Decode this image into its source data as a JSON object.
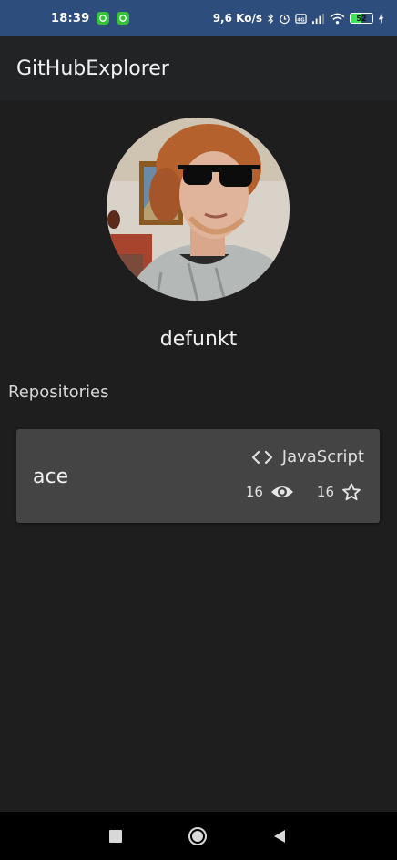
{
  "status_bar": {
    "time": "18:39",
    "network_speed": "9,6 Ko/s",
    "battery_level": "52",
    "accent_color": "#2d4d7c"
  },
  "app_bar": {
    "title": "GitHubExplorer"
  },
  "profile": {
    "username": "defunkt",
    "avatar_icon": "user-avatar"
  },
  "repositories": {
    "section_title": "Repositories",
    "items": [
      {
        "name": "ace",
        "language": "JavaScript",
        "watchers": "16",
        "stars": "16"
      }
    ]
  },
  "nav": {
    "recents_icon": "square-icon",
    "home_icon": "circle-icon",
    "back_icon": "triangle-icon"
  }
}
